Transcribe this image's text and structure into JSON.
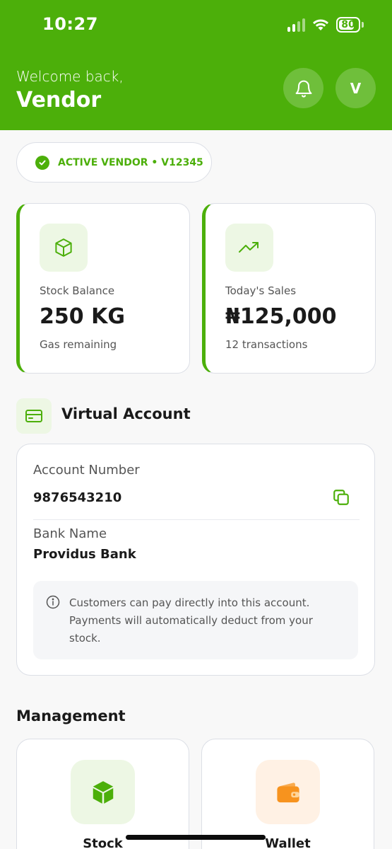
{
  "status_bar": {
    "time": "10:27",
    "battery": "80",
    "battery_level": 0.8
  },
  "header": {
    "greeting": "Welcome back,",
    "name": "Vendor",
    "avatar_initial": "V",
    "notification_icon": "bell-icon",
    "background_color": "#4caf0a"
  },
  "vendor_status": {
    "text": "ACTIVE VENDOR • V12345",
    "icon": "check-circle-icon",
    "color": "#4caf0a"
  },
  "stats": [
    {
      "icon": "box-icon",
      "label": "Stock Balance",
      "value": "250 KG",
      "sub": "Gas remaining"
    },
    {
      "icon": "trending-up-icon",
      "label": "Today's Sales",
      "value": "₦125,000",
      "sub": "12 transactions"
    }
  ],
  "virtual_account": {
    "title": "Virtual Account",
    "icon": "credit-card-icon",
    "account_number_label": "Account Number",
    "account_number": "9876543210",
    "copy_icon": "copy-icon",
    "bank_name_label": "Bank Name",
    "bank_name": "Providus Bank",
    "info_icon": "info-icon",
    "note": "Customers can pay directly into this account. Payments will automatically deduct from your stock."
  },
  "management": {
    "title": "Management",
    "items": [
      {
        "label": "Stock",
        "icon": "cube-icon",
        "color": "#4caf0a"
      },
      {
        "label": "Wallet",
        "icon": "wallet-icon",
        "color": "#f7931e"
      }
    ]
  },
  "colors": {
    "primary": "#4caf0a",
    "accent_orange": "#f7931e"
  }
}
